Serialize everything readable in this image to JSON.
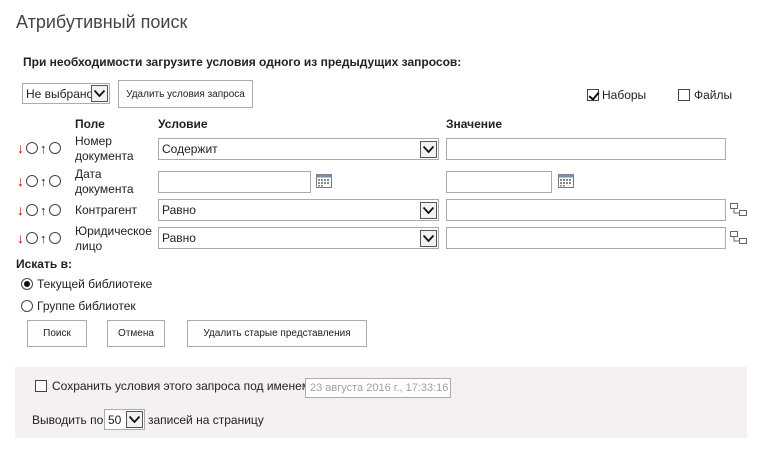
{
  "page": {
    "title": "Атрибутивный поиск",
    "prompt": "При необходимости загрузите условия одного из предыдущих запросов:"
  },
  "saved_query": {
    "selected": "Не выбрано",
    "delete_button": "Удалить условия запроса"
  },
  "scope_checks": [
    {
      "label": "Наборы",
      "checked": true
    },
    {
      "label": "Файлы",
      "checked": false
    }
  ],
  "headers": {
    "field": "Поле",
    "condition": "Условие",
    "value": "Значение"
  },
  "rows": [
    {
      "field": "Номер документа",
      "condition": "Содержит",
      "value": ""
    },
    {
      "field": "Дата документа",
      "condition": "",
      "value": ""
    },
    {
      "field": "Контрагент",
      "condition": "Равно",
      "value": ""
    },
    {
      "field": "Юридическое лицо",
      "condition": "Равно",
      "value": ""
    }
  ],
  "search_in": {
    "label": "Искать в:",
    "options": [
      {
        "label": "Текущей библиотеке",
        "selected": true
      },
      {
        "label": "Группе библиотек",
        "selected": false
      }
    ]
  },
  "actions": {
    "search": "Поиск",
    "cancel": "Отмена",
    "delete_old": "Удалить старые представления"
  },
  "save": {
    "label": "Сохранить условия этого запроса под именем",
    "checked": false,
    "name_value": "23 августа 2016 г., 17:33:16"
  },
  "paging": {
    "prefix": "Выводить по",
    "page_size": "50",
    "suffix": "записей на страницу"
  },
  "colors": {
    "down_arrow": "#c00000",
    "panel_background": "#f4f0f4"
  }
}
